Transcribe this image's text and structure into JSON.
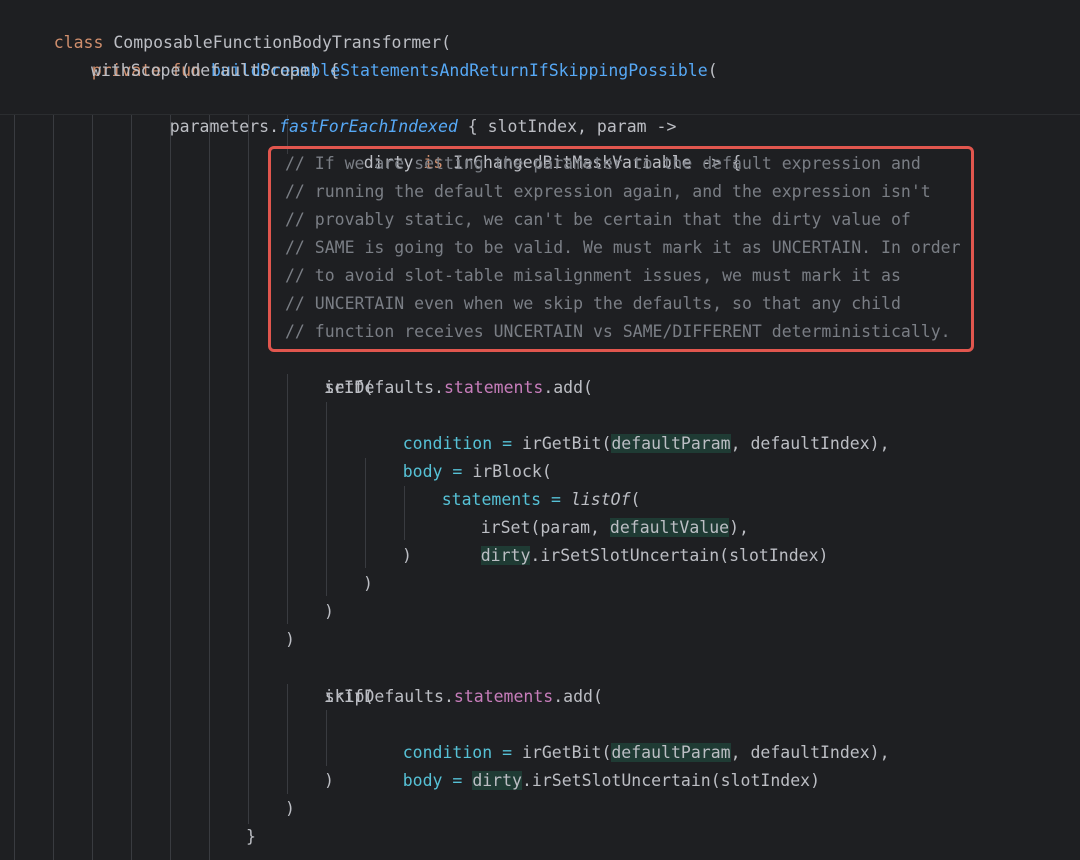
{
  "sticky_header": {
    "line1": {
      "kw": "class",
      "name": "ComposableFunctionBodyTransformer("
    },
    "line2": {
      "kw1": "private",
      "kw2": "fun",
      "name": "buildPreambleStatementsAndReturnIfSkippingPossible",
      "paren": "("
    },
    "line3": {
      "text": "withScope(defaultScope) {"
    },
    "line4": {
      "recv": "parameters.",
      "ext": "fastForEachIndexed",
      "rest": " { slotIndex, param ->"
    }
  },
  "code": {
    "dirty_line": {
      "a": "dirty ",
      "kw": "is",
      "b": " IrChangedBitMaskVariable -> {"
    },
    "comments": [
      "// If we are setting the parameter to the default expression and",
      "// running the default expression again, and the expression isn't",
      "// provably static, we can't be certain that the dirty value of",
      "// SAME is going to be valid. We must mark it as UNCERTAIN. In order",
      "// to avoid slot-table misalignment issues, we must mark it as",
      "// UNCERTAIN even when we skip the defaults, so that any child",
      "// function receives UNCERTAIN vs SAME/DIFFERENT deterministically."
    ],
    "set_defaults": {
      "obj": "setDefaults.",
      "prop": "statements",
      "call": ".add("
    },
    "irif1": "irIf(",
    "cond1": {
      "name": "condition",
      "eq": " = ",
      "fn": "irGetBit(",
      "arg": "defaultParam",
      "rest": ", defaultIndex),"
    },
    "body1": {
      "name": "body",
      "eq": " = ",
      "fn": "irBlock("
    },
    "statements": {
      "name": "statements",
      "eq": " = ",
      "fn": "listOf",
      "paren": "("
    },
    "irset": {
      "a": "irSet(param, ",
      "arg": "defaultValue",
      "b": "),"
    },
    "uncertain1": {
      "arg": "dirty",
      "rest": ".irSetSlotUncertain(slotIndex)"
    },
    "close_paren": ")",
    "close_brace": "}",
    "skip_defaults": {
      "obj": "skipDefaults.",
      "prop": "statements",
      "call": ".add("
    },
    "irif2": "irIf(",
    "cond2": {
      "name": "condition",
      "eq": " = ",
      "fn": "irGetBit(",
      "arg": "defaultParam",
      "rest": ", defaultIndex),"
    },
    "body2": {
      "name": "body",
      "eq": " = ",
      "arg": "dirty",
      "rest": ".irSetSlotUncertain(slotIndex)"
    }
  },
  "colors": {
    "background": "#1e1f22",
    "keyword": "#cf8e6d",
    "function": "#56a8f5",
    "comment": "#7a7e85",
    "property": "#c77dbb",
    "named_arg": "#56c1d6",
    "highlight_box": "#e1564e"
  }
}
